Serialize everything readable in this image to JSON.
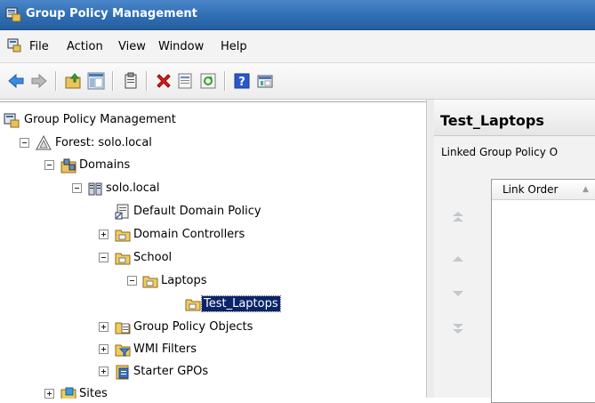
{
  "window": {
    "title": "Group Policy Management"
  },
  "menu": [
    "File",
    "Action",
    "View",
    "Window",
    "Help"
  ],
  "toolbar_icons": [
    "back-icon",
    "forward-icon",
    "up-folder-icon",
    "show-hide-tree-icon",
    "clipboard-icon",
    "delete-icon",
    "properties-icon",
    "refresh-icon",
    "help-icon",
    "console-icon"
  ],
  "tree": {
    "root": "Group Policy Management",
    "forest": "Forest: solo.local",
    "domains": "Domains",
    "domain": "solo.local",
    "default_policy": "Default Domain Policy",
    "domain_controllers": "Domain Controllers",
    "school": "School",
    "laptops": "Laptops",
    "test_laptops": "Test_Laptops",
    "gpo": "Group Policy Objects",
    "wmi": "WMI Filters",
    "starter": "Starter GPOs",
    "sites": "Sites"
  },
  "detail": {
    "title": "Test_Laptops",
    "tab": "Linked Group Policy O",
    "column": "Link Order"
  }
}
